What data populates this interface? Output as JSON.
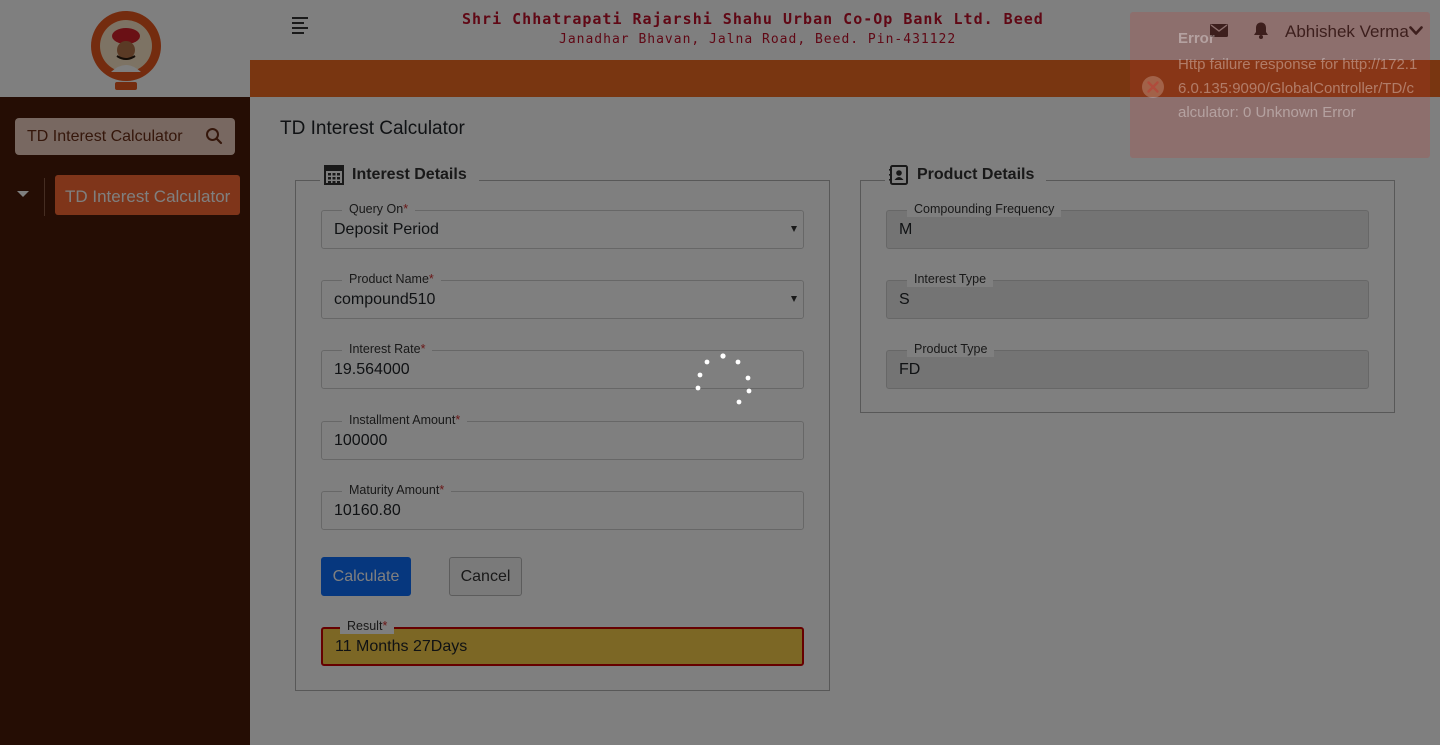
{
  "sidebar": {
    "search_label": "TD Interest Calculator",
    "menu_item": "TD Interest Calculator"
  },
  "header": {
    "bank_name": "Shri Chhatrapati Rajarshi Shahu Urban Co-Op Bank Ltd. Beed",
    "bank_address": "Janadhar Bhavan, Jalna Road, Beed. Pin-431122",
    "user_name": "Abhishek Verma"
  },
  "page": {
    "title": "TD Interest Calculator"
  },
  "interest_details": {
    "legend": "Interest Details",
    "query_on": {
      "label": "Query On",
      "value": "Deposit Period"
    },
    "product_name": {
      "label": "Product Name",
      "value": "compound510"
    },
    "interest_rate": {
      "label": "Interest Rate",
      "value": "19.564000"
    },
    "installment_amount": {
      "label": "Installment Amount",
      "value": "100000"
    },
    "maturity_amount": {
      "label": "Maturity Amount",
      "value": "10160.80"
    },
    "calculate_label": "Calculate",
    "cancel_label": "Cancel",
    "result": {
      "label": "Result",
      "value": "11 Months 27Days"
    },
    "required_mark": "*"
  },
  "product_details": {
    "legend": "Product Details",
    "compounding_frequency": {
      "label": "Compounding Frequency",
      "value": "M"
    },
    "interest_type": {
      "label": "Interest Type",
      "value": "S"
    },
    "product_type": {
      "label": "Product Type",
      "value": "FD"
    }
  },
  "toast": {
    "title": "Error",
    "message": "Http failure response for http://172.16.0.135:9090/GlobalController/TD/calculator: 0 Unknown Error"
  },
  "colors": {
    "sidebar_bg": "#4a1a08",
    "accent_orange": "#f26c22",
    "bank_red": "#c0102a",
    "primary_blue": "#0d6efd",
    "result_yellow": "#f8cf4a",
    "error_red": "#bd362f"
  },
  "icons": {
    "menu": "hamburger-icon",
    "search": "search-icon",
    "mail": "mail-icon",
    "notifications": "bell-icon",
    "user_menu": "chevron-down-icon",
    "interest_details": "calculator-icon",
    "product_details": "contact-card-icon",
    "loading": "spinner-icon",
    "error": "error-circle-icon"
  }
}
